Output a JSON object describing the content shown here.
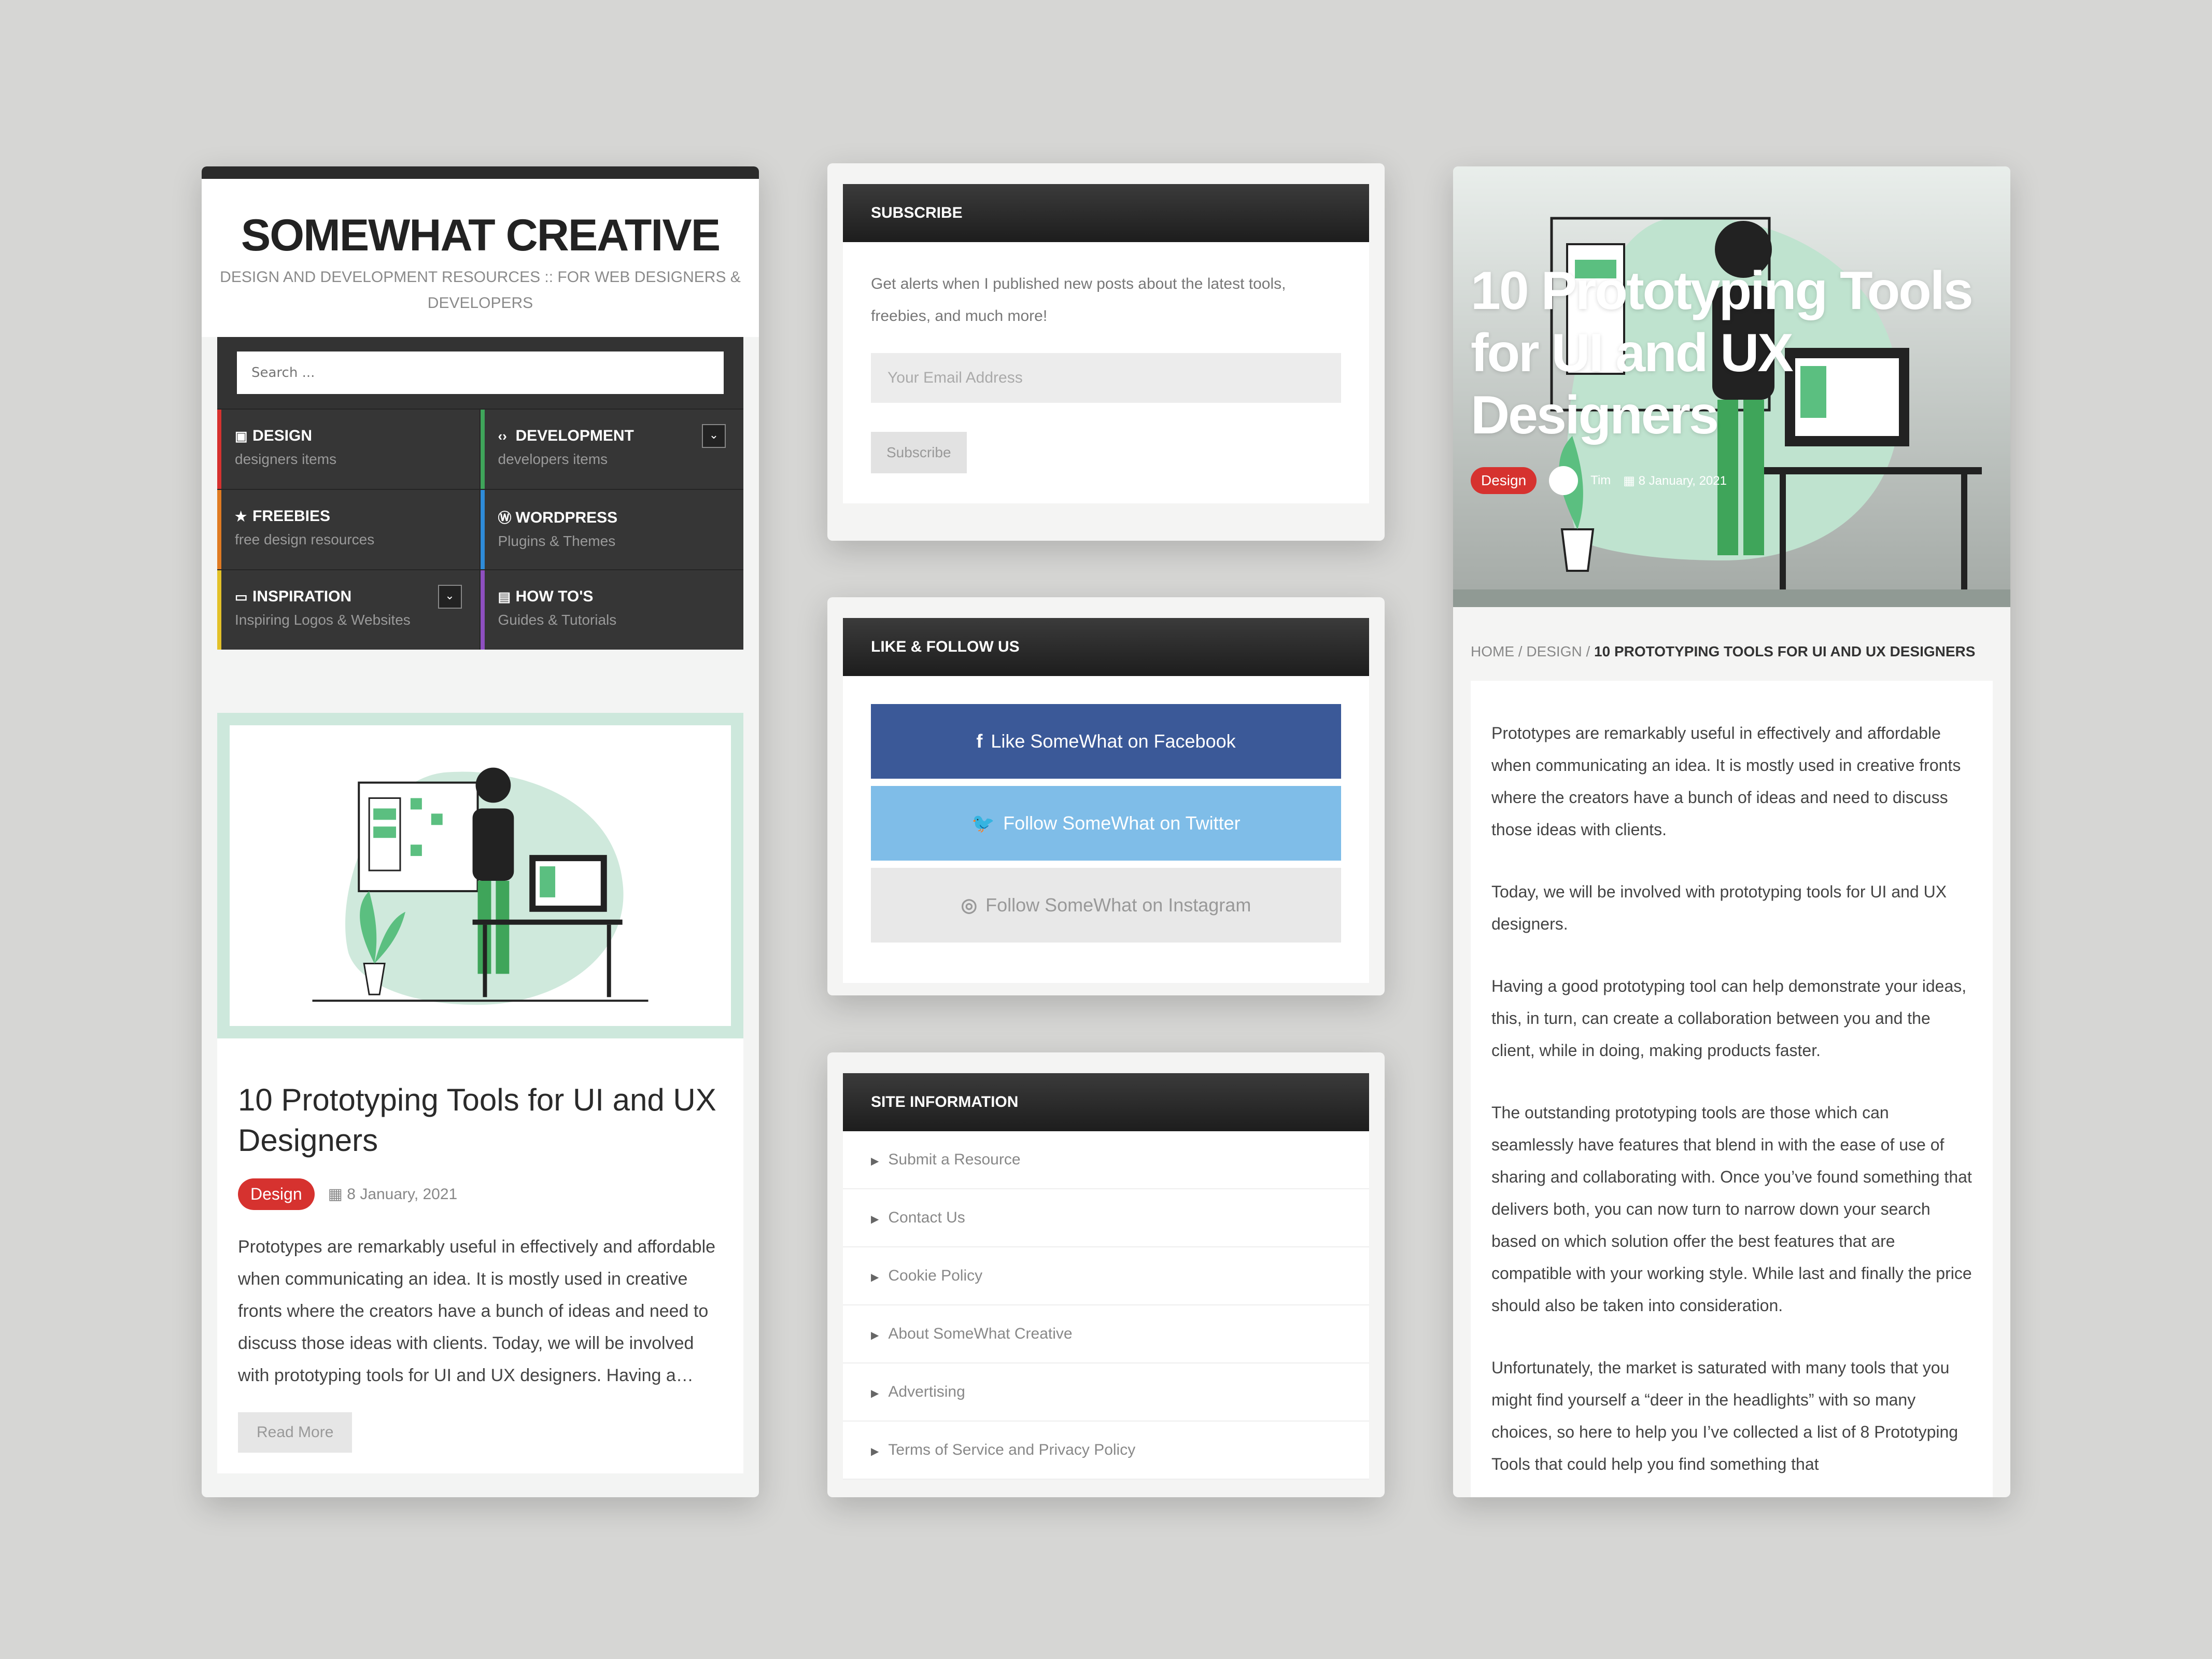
{
  "left": {
    "site_title": "SOMEWHAT CREATIVE",
    "tagline": "DESIGN AND DEVELOPMENT RESOURCES :: FOR WEB DESIGNERS & DEVELOPERS",
    "search_placeholder": "Search ...",
    "nav": [
      {
        "title": "DESIGN",
        "sub": "designers items",
        "icon": "image-icon",
        "color": "#d6322f"
      },
      {
        "title": "DEVELOPMENT",
        "sub": "developers items",
        "icon": "code-icon",
        "color": "#3fa55a"
      },
      {
        "title": "FREEBIES",
        "sub": "free design resources",
        "icon": "star-icon",
        "color": "#e07b22"
      },
      {
        "title": "WORDPRESS",
        "sub": "Plugins & Themes",
        "icon": "wordpress-icon",
        "color": "#2e8bd8"
      },
      {
        "title": "INSPIRATION",
        "sub": "Inspiring Logos & Websites",
        "icon": "monitor-icon",
        "color": "#e3c129"
      },
      {
        "title": "HOW TO'S",
        "sub": "Guides & Tutorials",
        "icon": "book-icon",
        "color": "#8e4fc0"
      }
    ],
    "post": {
      "title": "10 Prototyping Tools for UI and UX Designers",
      "tag": "Design",
      "date": "8 January, 2021",
      "excerpt": "Prototypes are remarkably useful in effectively and affordable when communicating an idea. It is mostly used in creative fronts where the creators have a bunch of ideas and need to discuss those ideas with clients. Today, we will be involved with prototyping tools for UI and UX designers. Having a…",
      "read_more": "Read More"
    }
  },
  "subscribe": {
    "heading": "SUBSCRIBE",
    "text": "Get alerts when I published new posts about the latest tools, freebies, and much more!",
    "email_placeholder": "Your Email Address",
    "button": "Subscribe"
  },
  "follow": {
    "heading": "LIKE & FOLLOW US",
    "facebook": "Like SomeWhat on Facebook",
    "twitter": "Follow SomeWhat on Twitter",
    "instagram": "Follow SomeWhat on Instagram",
    "colors": {
      "facebook": "#3b5998",
      "twitter": "#7fbde8",
      "instagram": "#e8e8e8"
    }
  },
  "info": {
    "heading": "SITE INFORMATION",
    "items": [
      "Submit a Resource",
      "Contact Us",
      "Cookie Policy",
      "About SomeWhat Creative",
      "Advertising",
      "Terms of Service and Privacy Policy"
    ]
  },
  "right": {
    "hero_title": "10 Prototyping Tools for UI and UX Designers",
    "tag": "Design",
    "author": "Tim",
    "date": "8 January, 2021",
    "breadcrumb": {
      "home": "HOME",
      "cat": "DESIGN",
      "current": "10 PROTOTYPING TOOLS FOR UI AND UX DESIGNERS"
    },
    "paragraphs": [
      "Prototypes are remarkably useful in effectively and affordable when communicating an idea. It is mostly used in creative fronts where the creators have a bunch of ideas and need to discuss those ideas with clients.",
      "Today, we will be involved with prototyping tools for UI and UX designers.",
      "Having a good prototyping tool can help demonstrate your ideas, this, in turn, can create a collaboration between you and the client, while in doing, making products faster.",
      "The outstanding prototyping tools are those which can seamlessly have features that blend in with the ease of use of sharing and collaborating with. Once you’ve found something that delivers both, you can now turn to narrow down your search based on which solution offer the best features that are compatible with your working style. While last and finally the price should also be taken into consideration.",
      "Unfortunately, the market is saturated with many tools that you might find yourself a “deer in the headlights” with so many choices, so here to help you I’ve collected a list of 8 Prototyping Tools that could help you find something that"
    ]
  }
}
